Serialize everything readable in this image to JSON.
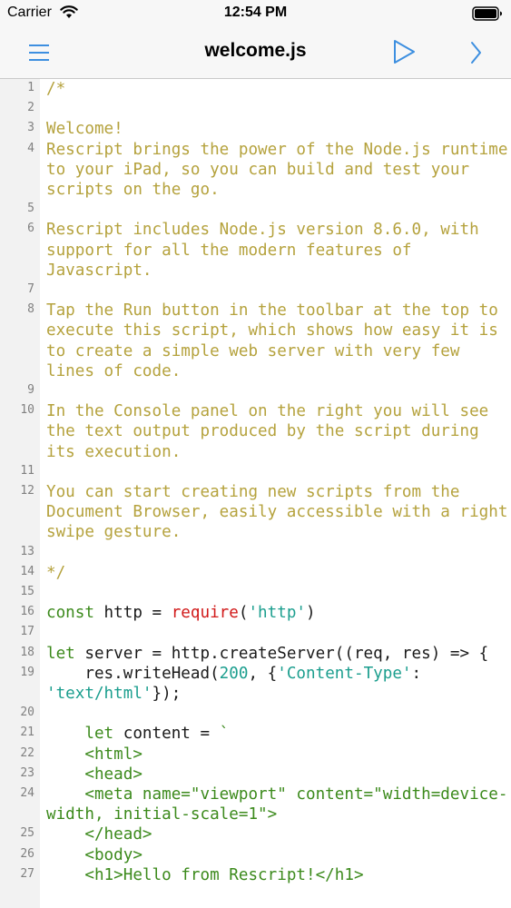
{
  "status": {
    "carrier": "Carrier",
    "time": "12:54 PM"
  },
  "nav": {
    "title": "welcome.js",
    "menu_icon": "hamburger-icon",
    "run_icon": "play-icon",
    "console_icon": "chevron-right-icon",
    "accent_color": "#3d8fe0"
  },
  "editor": {
    "colors": {
      "comment": "#b5a23d",
      "keyword": "#3c8a1c",
      "builtin": "#d11919",
      "string": "#1b9e8e",
      "gutter": "#f2f2f2"
    },
    "lines": [
      {
        "n": "1",
        "tokens": [
          {
            "t": "/*",
            "k": "c"
          }
        ]
      },
      {
        "n": "2",
        "tokens": []
      },
      {
        "n": "3",
        "tokens": [
          {
            "t": "Welcome!",
            "k": "c"
          }
        ]
      },
      {
        "n": "4",
        "tokens": [
          {
            "t": "Rescript brings the power of the Node.js runtime to your iPad, so you can build and test your scripts on the go.",
            "k": "c"
          }
        ]
      },
      {
        "n": "5",
        "tokens": []
      },
      {
        "n": "6",
        "tokens": [
          {
            "t": "Rescript includes Node.js version 8.6.0, with support for all the modern features of Javascript.",
            "k": "c"
          }
        ]
      },
      {
        "n": "7",
        "tokens": []
      },
      {
        "n": "8",
        "tokens": [
          {
            "t": "Tap the Run button in the toolbar at the top to execute this script, which shows how easy it is to create a simple web server with very few lines of code.",
            "k": "c"
          }
        ]
      },
      {
        "n": "9",
        "tokens": []
      },
      {
        "n": "10",
        "tokens": [
          {
            "t": "In the Console panel on the right you will see the text output produced by the script during its execution.",
            "k": "c"
          }
        ]
      },
      {
        "n": "11",
        "tokens": []
      },
      {
        "n": "12",
        "tokens": [
          {
            "t": "You can start creating new scripts from the Document Browser, easily accessible with a right swipe gesture.",
            "k": "c"
          }
        ]
      },
      {
        "n": "13",
        "tokens": []
      },
      {
        "n": "14",
        "tokens": [
          {
            "t": "*/",
            "k": "c"
          }
        ]
      },
      {
        "n": "15",
        "tokens": []
      },
      {
        "n": "16",
        "tokens": [
          {
            "t": "const",
            "k": "kw"
          },
          {
            "t": " http = ",
            "k": "pl"
          },
          {
            "t": "require",
            "k": "fn"
          },
          {
            "t": "(",
            "k": "pl"
          },
          {
            "t": "'http'",
            "k": "str"
          },
          {
            "t": ")",
            "k": "pl"
          }
        ]
      },
      {
        "n": "17",
        "tokens": []
      },
      {
        "n": "18",
        "tokens": [
          {
            "t": "let",
            "k": "kw"
          },
          {
            "t": " server = http.createServer((req, res) => {",
            "k": "pl"
          }
        ]
      },
      {
        "n": "19",
        "tokens": [
          {
            "t": "    res.writeHead(",
            "k": "pl"
          },
          {
            "t": "200",
            "k": "num"
          },
          {
            "t": ", {",
            "k": "pl"
          },
          {
            "t": "'Content-Type'",
            "k": "str"
          },
          {
            "t": ": ",
            "k": "pl"
          },
          {
            "t": "'text/html'",
            "k": "str"
          },
          {
            "t": "});",
            "k": "pl"
          }
        ]
      },
      {
        "n": "20",
        "tokens": []
      },
      {
        "n": "21",
        "tokens": [
          {
            "t": "    ",
            "k": "pl"
          },
          {
            "t": "let",
            "k": "kw"
          },
          {
            "t": " content = ",
            "k": "pl"
          },
          {
            "t": "`",
            "k": "tpl"
          }
        ]
      },
      {
        "n": "22",
        "tokens": [
          {
            "t": "    <html>",
            "k": "tpl"
          }
        ]
      },
      {
        "n": "23",
        "tokens": [
          {
            "t": "    <head>",
            "k": "tpl"
          }
        ]
      },
      {
        "n": "24",
        "tokens": [
          {
            "t": "    <meta name=\"viewport\" content=\"width=device-width, initial-scale=1\">",
            "k": "tpl"
          }
        ]
      },
      {
        "n": "25",
        "tokens": [
          {
            "t": "    </head>",
            "k": "tpl"
          }
        ]
      },
      {
        "n": "26",
        "tokens": [
          {
            "t": "    <body>",
            "k": "tpl"
          }
        ]
      },
      {
        "n": "27",
        "tokens": [
          {
            "t": "    <h1>Hello from Rescript!</h1>",
            "k": "tpl"
          }
        ]
      }
    ]
  }
}
